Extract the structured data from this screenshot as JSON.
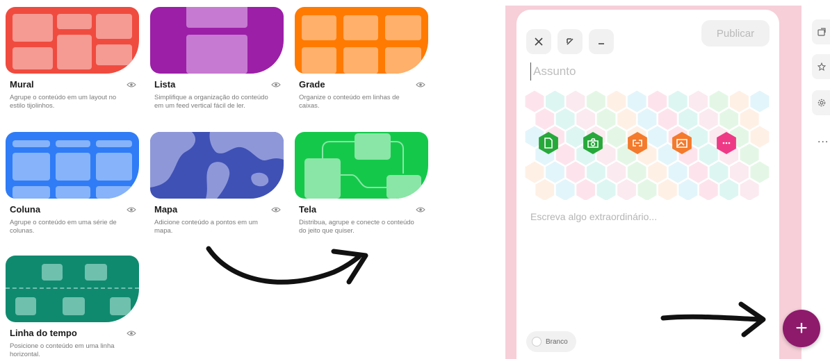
{
  "layouts": [
    {
      "id": "mural",
      "title": "Mural",
      "description": "Agrupe o conteúdo em um layout no estilo tijolinhos.",
      "color": "#f04b3f"
    },
    {
      "id": "lista",
      "title": "Lista",
      "description": "Simplifique a organização do conteúdo em um feed vertical fácil de ler.",
      "color": "#9c1fa8"
    },
    {
      "id": "grade",
      "title": "Grade",
      "description": "Organize o conteúdo em linhas de caixas.",
      "color": "#ff7a00"
    },
    {
      "id": "coluna",
      "title": "Coluna",
      "description": "Agrupe o conteúdo em uma série de colunas.",
      "color": "#2f7cf6"
    },
    {
      "id": "mapa",
      "title": "Mapa",
      "description": "Adicione conteúdo a pontos em um mapa.",
      "color": "#3f51b5"
    },
    {
      "id": "tela",
      "title": "Tela",
      "description": "Distribua, agrupe e conecte o conteúdo do jeito que quiser.",
      "color": "#14c94a"
    },
    {
      "id": "linha_do_tempo",
      "title": "Linha do tempo",
      "description": "Posicione o conteúdo em uma linha horizontal.",
      "color": "#0f8a6f"
    }
  ],
  "composer": {
    "close_icon": "close-icon",
    "expand_icon": "expand-icon",
    "minimize_icon": "minimize-icon",
    "publish_label": "Publicar",
    "subject_placeholder": "Assunto",
    "body_placeholder": "Escreva algo extraordinário...",
    "color_label": "Branco",
    "attachments": [
      {
        "icon": "file-upload-icon",
        "color": "#27a83a"
      },
      {
        "icon": "camera-icon",
        "color": "#27a83a"
      },
      {
        "icon": "link-icon",
        "color": "#f47a2c"
      },
      {
        "icon": "image-search-icon",
        "color": "#f47a2c"
      },
      {
        "icon": "more-icon",
        "color": "#ee3a86"
      }
    ]
  },
  "fab": {
    "label": "+",
    "color": "#8e1a6c"
  },
  "side_toolbar": {
    "icons": [
      "share-icon",
      "star-icon",
      "settings-icon"
    ],
    "more_label": "..."
  },
  "colors": {
    "board_background": "#f6cfd8"
  }
}
